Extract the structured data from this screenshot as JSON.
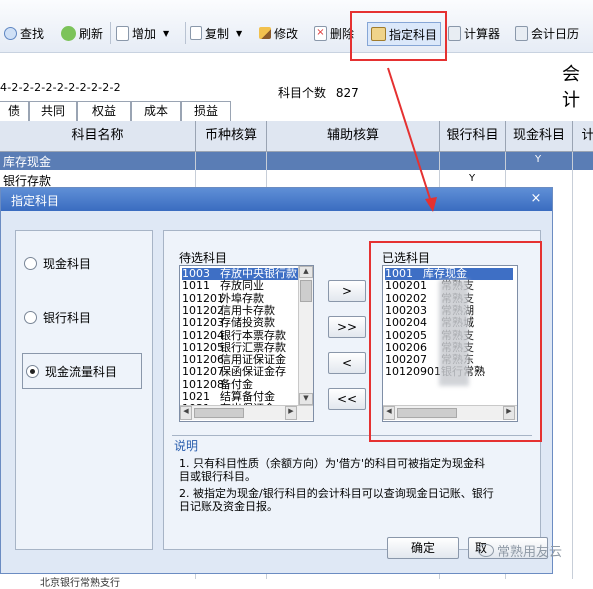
{
  "toolbar": {
    "buttons": [
      {
        "label": "查找",
        "icon": "magnifier-icon"
      },
      {
        "label": "刷新",
        "icon": "refresh-icon"
      },
      {
        "label": "增加",
        "icon": "add-page-icon"
      },
      {
        "label": "复制",
        "icon": "copy-icon"
      },
      {
        "label": "修改",
        "icon": "pencil-icon"
      },
      {
        "label": "删除",
        "icon": "delete-icon"
      },
      {
        "label": "指定科目",
        "icon": "assign-icon"
      },
      {
        "label": "计算器",
        "icon": "calculator-icon"
      },
      {
        "label": "会计日历",
        "icon": "calendar-icon"
      }
    ]
  },
  "header": {
    "code_scheme": "4-2-2-2-2-2-2-2-2-2-2",
    "count_label": "科目个数",
    "count_value": "827",
    "title_partial": "会计"
  },
  "tabs": [
    "债",
    "共同",
    "权益",
    "成本",
    "损益"
  ],
  "grid": {
    "columns": [
      "科目名称",
      "币种核算",
      "辅助核算",
      "银行科目",
      "现金科目",
      "计"
    ],
    "rows": [
      {
        "name": "库存现金",
        "cash": "Y",
        "bank": ""
      },
      {
        "name": "银行存款",
        "cash": "",
        "bank": "Y"
      }
    ],
    "footer_partial": "北京银行常熟支行"
  },
  "dialog": {
    "title": "指定科目",
    "close_glyph": "×",
    "radios": [
      {
        "label": "现金科目",
        "checked": false
      },
      {
        "label": "银行科目",
        "checked": false
      },
      {
        "label": "现金流量科目",
        "checked": true
      }
    ],
    "candidate": {
      "label": "待选科目",
      "items": [
        {
          "code": "1003",
          "name": "存放中央银行款"
        },
        {
          "code": "1011",
          "name": "存放同业"
        },
        {
          "code": "101201",
          "name": "外埠存款"
        },
        {
          "code": "101202",
          "name": "信用卡存款"
        },
        {
          "code": "101203",
          "name": "存储投资款"
        },
        {
          "code": "101204",
          "name": "银行本票存款"
        },
        {
          "code": "101205",
          "name": "银行汇票存款"
        },
        {
          "code": "101206",
          "name": "信用证保证金"
        },
        {
          "code": "101207",
          "name": "保函保证金存"
        },
        {
          "code": "101208",
          "name": "备付金"
        },
        {
          "code": "1021",
          "name": "结算备付金"
        },
        {
          "code": "1031",
          "name": "存出保证金"
        }
      ]
    },
    "selected": {
      "label": "已选科目",
      "items": [
        {
          "code": "1001",
          "name": "库存现金"
        },
        {
          "code": "100201",
          "name": "常熟支"
        },
        {
          "code": "100202",
          "name": "常熟支"
        },
        {
          "code": "100203",
          "name": "常熟湖"
        },
        {
          "code": "100204",
          "name": "常熟城"
        },
        {
          "code": "100205",
          "name": "常熟支"
        },
        {
          "code": "100206",
          "name": "常熟支"
        },
        {
          "code": "100207",
          "name": "常熟东"
        },
        {
          "code": "10120901",
          "name": "银行常熟"
        }
      ]
    },
    "move_buttons": [
      ">",
      ">>",
      "<",
      "<<"
    ],
    "note_title": "说明",
    "note_lines": [
      "1. 只有科目性质（余额方向）为'借方'的科目可被指定为现金科",
      "目或银行科目。",
      "2. 被指定为现金/银行科目的会计科目可以查询现金日记账、银行",
      "日记账及资金日报。"
    ],
    "confirm_label": "确定",
    "cancel_partial": "取"
  },
  "watermark": "常熟用友云",
  "colors": {
    "highlight": "#e53131",
    "selection": "#3e6fc5",
    "title_bar": "#3a6cc0"
  }
}
